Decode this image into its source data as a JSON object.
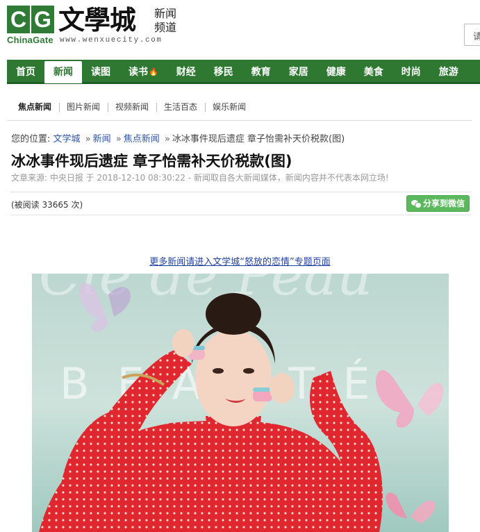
{
  "logo": {
    "cg_c": "C",
    "cg_g": "G",
    "chinagate": "ChinaGate",
    "wenxuecheng": "文學城",
    "channel_line1": "新闻",
    "channel_line2": "频道",
    "url": "www.wenxuecity.com",
    "brand_green": "#2f7b36"
  },
  "search": {
    "placeholder": "请"
  },
  "mainnav": {
    "items": [
      {
        "label": "首页"
      },
      {
        "label": "新闻",
        "active": true
      },
      {
        "label": "读图"
      },
      {
        "label": "读书",
        "icon": "fire-icon"
      },
      {
        "label": "财经"
      },
      {
        "label": "移民"
      },
      {
        "label": "教育"
      },
      {
        "label": "家居"
      },
      {
        "label": "健康"
      },
      {
        "label": "美食"
      },
      {
        "label": "时尚"
      },
      {
        "label": "旅游"
      }
    ],
    "bg_color": "#2e7832"
  },
  "subnav": {
    "items": [
      {
        "label": "焦点新闻"
      },
      {
        "label": "图片新闻"
      },
      {
        "label": "视频新闻"
      },
      {
        "label": "生活百态"
      },
      {
        "label": "娱乐新闻"
      }
    ]
  },
  "breadcrumb": {
    "prefix": "您的位置:",
    "crumbs": [
      "文学城",
      "新闻",
      "焦点新闻"
    ],
    "separator": "»",
    "current": "冰冰事件现后遗症 章子怡需补天价税款(图)"
  },
  "article": {
    "title": "冰冰事件现后遗症 章子怡需补天价税款(图)",
    "meta": "文章来源: 中央日报 于 2018-12-10 08:30:22 - 新闻取自各大新闻媒体，新闻内容并不代表本网立场!",
    "read_count": "(被阅读 33665 次)",
    "share_label": "分享到微信",
    "topic_link": "更多新闻请进入文学城“怒放的恋情”专题页面",
    "photo_text": "BEAUTÉ"
  }
}
